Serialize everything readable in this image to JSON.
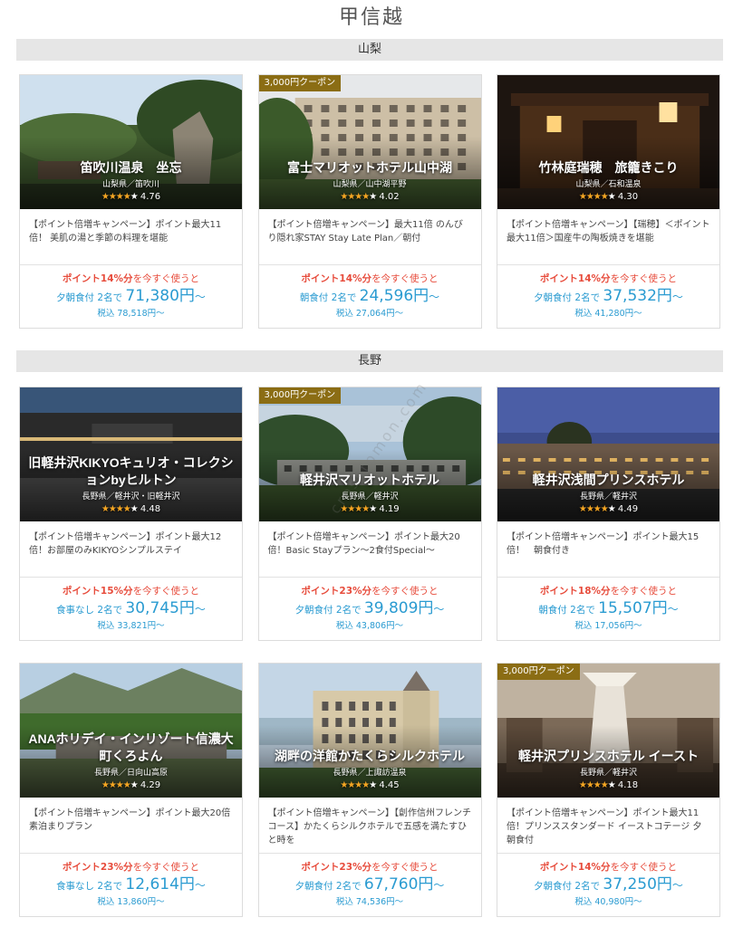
{
  "page_title": "甲信越",
  "watermark": "crosstomon.com",
  "colors": {
    "coupon_bg": "#8b6d14",
    "points_red": "#e74c3c",
    "price_blue": "#2a9bd1",
    "star": "#f5a623"
  },
  "regions": [
    {
      "name": "山梨",
      "cards": [
        {
          "coupon": "",
          "name": "笛吹川温泉　坐忘",
          "location": "山梨県／笛吹川",
          "stars": 4,
          "rating": "4.76",
          "description": "【ポイント倍増キャンペーン】ポイント最大11倍！ 美肌の湯と季節の料理を堪能",
          "points_pct": "ポイント14%分",
          "points_suffix": "を今すぐ使うと",
          "meal": "夕朝食付 2名で ",
          "price": "71,380円",
          "price_suffix": "～",
          "tax": "税込 78,518円～",
          "scene": "garden"
        },
        {
          "coupon": "3,000円クーポン",
          "name": "富士マリオットホテル山中湖",
          "location": "山梨県／山中湖平野",
          "stars": 4,
          "rating": "4.02",
          "description": "【ポイント倍増キャンペーン】最大11倍 のんびり隠れ家STAY Stay Late Plan／朝付",
          "points_pct": "ポイント14%分",
          "points_suffix": "を今すぐ使うと",
          "meal": "朝食付 2名で ",
          "price": "24,596円",
          "price_suffix": "～",
          "tax": "税込 27,064円～",
          "scene": "building"
        },
        {
          "coupon": "",
          "name": "竹林庭瑞穂　旅籠きこり",
          "location": "山梨県／石和温泉",
          "stars": 4,
          "rating": "4.30",
          "description": "【ポイント倍増キャンペーン】【瑞穂】＜ポイント最大11倍＞国産牛の陶板焼きを堪能",
          "points_pct": "ポイント14%分",
          "points_suffix": "を今すぐ使うと",
          "meal": "夕朝食付 2名で ",
          "price": "37,532円",
          "price_suffix": "～",
          "tax": "税込 41,280円～",
          "scene": "night"
        }
      ]
    },
    {
      "name": "長野",
      "cards": [
        {
          "coupon": "",
          "name": "旧軽井沢KIKYOキュリオ・コレクションbyヒルトン",
          "location": "長野県／軽井沢・旧軽井沢",
          "stars": 4,
          "rating": "4.48",
          "description": "【ポイント倍増キャンペーン】ポイント最大12倍！お部屋のみKIKYOシンプルステイ",
          "points_pct": "ポイント15%分",
          "points_suffix": "を今すぐ使うと",
          "meal": "食事なし 2名で ",
          "price": "30,745円",
          "price_suffix": "～",
          "tax": "税込 33,821円～",
          "scene": "dusk"
        },
        {
          "coupon": "3,000円クーポン",
          "name": "軽井沢マリオットホテル",
          "location": "長野県／軽井沢",
          "stars": 4,
          "rating": "4.19",
          "description": "【ポイント倍増キャンペーン】ポイント最大20倍！Basic Stayプラン～2食付Special～",
          "points_pct": "ポイント23%分",
          "points_suffix": "を今すぐ使うと",
          "meal": "夕朝食付 2名で ",
          "price": "39,809円",
          "price_suffix": "～",
          "tax": "税込 43,806円～",
          "scene": "forest"
        },
        {
          "coupon": "",
          "name": "軽井沢浅間プリンスホテル",
          "location": "長野県／軽井沢",
          "stars": 4,
          "rating": "4.49",
          "description": "【ポイント倍増キャンペーン】ポイント最大15倍！　朝食付き",
          "points_pct": "ポイント18%分",
          "points_suffix": "を今すぐ使うと",
          "meal": "朝食付 2名で ",
          "price": "15,507円",
          "price_suffix": "～",
          "tax": "税込 17,056円～",
          "scene": "twilight"
        }
      ]
    },
    {
      "name": "",
      "cards": [
        {
          "coupon": "",
          "name": "ANAホリデイ・インリゾート信濃大町くろよん",
          "location": "長野県／日向山高原",
          "stars": 4,
          "rating": "4.29",
          "description": "【ポイント倍増キャンペーン】ポイント最大20倍　素泊まりプラン",
          "points_pct": "ポイント23%分",
          "points_suffix": "を今すぐ使うと",
          "meal": "食事なし 2名で ",
          "price": "12,614円",
          "price_suffix": "～",
          "tax": "税込 13,860円～",
          "scene": "mountain"
        },
        {
          "coupon": "",
          "name": "湖畔の洋館かたくらシルクホテル",
          "location": "長野県／上諏訪温泉",
          "stars": 4,
          "rating": "4.45",
          "description": "【ポイント倍増キャンペーン】【創作信州フレンチコース】かたくらシルクホテルで五感を満たすひと時を",
          "points_pct": "ポイント23%分",
          "points_suffix": "を今すぐ使うと",
          "meal": "夕朝食付 2名で ",
          "price": "67,760円",
          "price_suffix": "～",
          "tax": "税込 74,536円～",
          "scene": "castle"
        },
        {
          "coupon": "3,000円クーポン",
          "name": "軽井沢プリンスホテル イースト",
          "location": "長野県／軽井沢",
          "stars": 4,
          "rating": "4.18",
          "description": "【ポイント倍増キャンペーン】ポイント最大11倍！プリンススタンダード イーストコテージ 夕朝食付",
          "points_pct": "ポイント14%分",
          "points_suffix": "を今すぐ使うと",
          "meal": "夕朝食付 2名で ",
          "price": "37,250円",
          "price_suffix": "～",
          "tax": "税込 40,980円～",
          "scene": "lobby"
        }
      ]
    }
  ]
}
